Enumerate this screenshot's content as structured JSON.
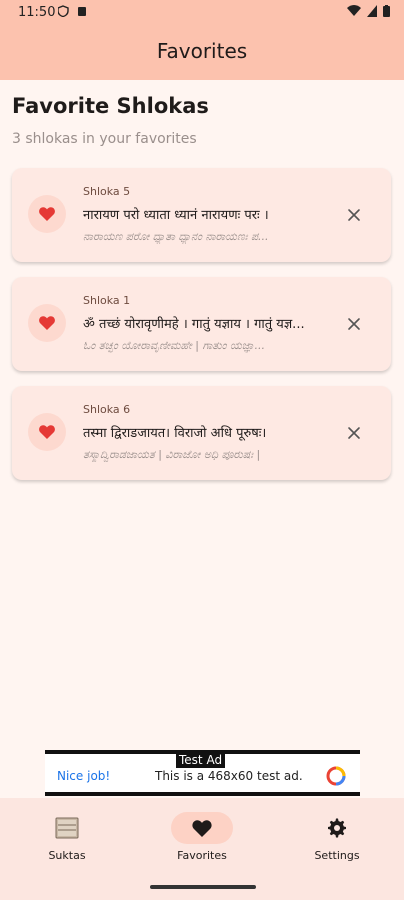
{
  "status_bar": {
    "time": "11:50"
  },
  "app_bar": {
    "title": "Favorites"
  },
  "header": {
    "title": "Favorite Shlokas",
    "subtitle": "3 shlokas in your favorites"
  },
  "favorites": [
    {
      "label": "Shloka 5",
      "sanskrit": "नारायण परो ध्याता ध्यानं नारायणः परः ।",
      "kannada": "ನಾರಾಯಣ ಪರೋ ಧ್ಯಾತಾ ಧ್ಯಾನಂ ನಾರಾಯಣಃ ಪ..."
    },
    {
      "label": "Shloka 1",
      "sanskrit": "ॐ तच्छं योरावृणीमहे । गातुं यज्ञाय । गातुं यज्ञ...",
      "kannada": "ಓಂ ತಚ್ಛಂ ಯೋರಾವೃಣೀಮಹೇ | ಗಾತುಂ ಯಜ್ಞಾ..."
    },
    {
      "label": "Shloka 6",
      "sanskrit": "तस्मा द्विराडजायत। विराजो अधि पूरुषः।",
      "kannada": "ತಸ್ಮಾದ್ವಿರಾಡಜಾಯತ | ವಿರಾಜೋ ಅಧಿ ಪೂರುಷಃ |"
    }
  ],
  "ad": {
    "tag": "Test Ad",
    "left_text": "Nice job!",
    "body_text": "This is a 468x60 test ad."
  },
  "bottom_nav": [
    {
      "label": "Suktas",
      "icon": "book-icon",
      "active": false
    },
    {
      "label": "Favorites",
      "icon": "heart-icon",
      "active": true
    },
    {
      "label": "Settings",
      "icon": "gear-icon",
      "active": false
    }
  ],
  "colors": {
    "accent": "#fcc2ae",
    "heart": "#e53935",
    "background": "#fff5f1"
  }
}
